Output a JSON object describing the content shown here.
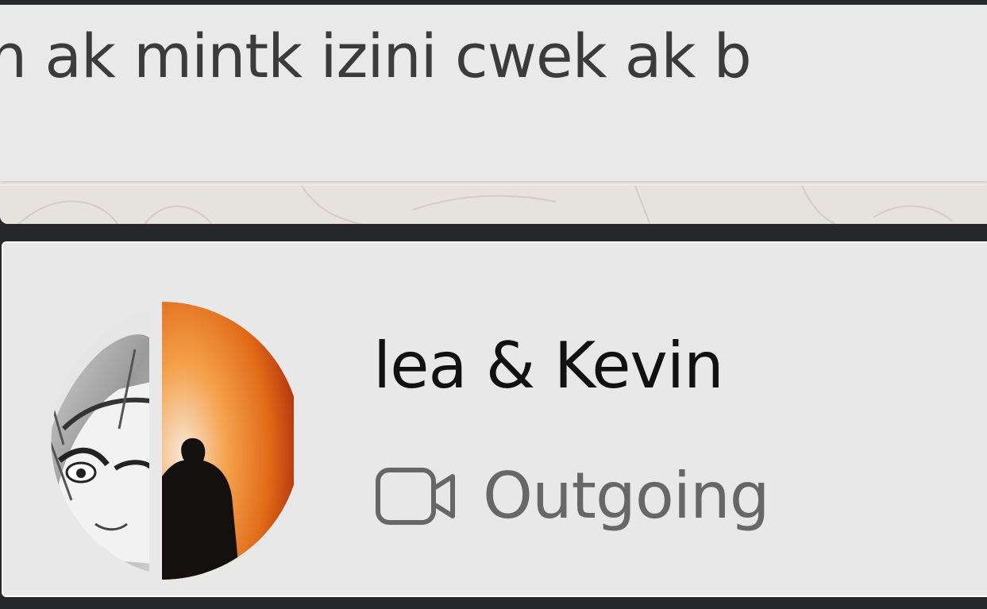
{
  "message": {
    "text": "n ak mintk izini cwek ak b"
  },
  "call": {
    "contact_name": "lea & Kevin",
    "status": "Outgoing",
    "status_icon": "video-camera-icon",
    "avatar_left": "hooded-manga-character",
    "avatar_right": "silhouette-orange-sunset"
  },
  "colors": {
    "background": "#25272b",
    "card": "#e8e8e8",
    "bubble": "#e9e9e9",
    "name_text": "#111111",
    "status_text": "#676767"
  }
}
